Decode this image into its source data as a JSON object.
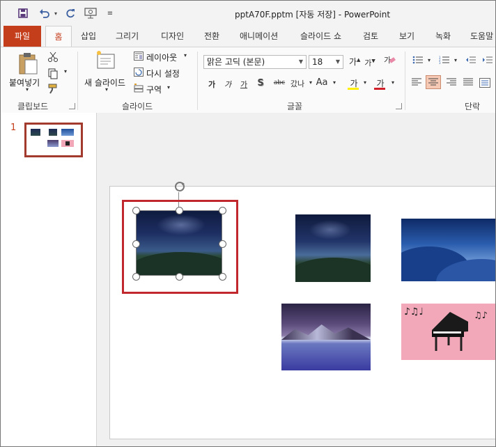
{
  "window": {
    "title": "pptA70F.pptm [자동 저장]  -  PowerPoint",
    "quick_access": [
      "save-icon",
      "undo-icon",
      "redo-icon",
      "present-icon",
      "customize-icon"
    ]
  },
  "tabs": [
    {
      "label": "파일"
    },
    {
      "label": "홈"
    },
    {
      "label": "삽입"
    },
    {
      "label": "그리기"
    },
    {
      "label": "디자인"
    },
    {
      "label": "전환"
    },
    {
      "label": "애니메이션"
    },
    {
      "label": "슬라이드 쇼"
    },
    {
      "label": "검토"
    },
    {
      "label": "보기"
    },
    {
      "label": "녹화"
    },
    {
      "label": "도움말"
    }
  ],
  "ribbon": {
    "clipboard": {
      "paste_label": "붙여넣기",
      "group_label": "클립보드"
    },
    "slides": {
      "new_slide_label": "새 슬라이드",
      "layout_label": "레이아웃",
      "reset_label": "다시 설정",
      "section_label": "구역",
      "group_label": "슬라이드"
    },
    "font": {
      "font_name": "맑은 고딕 (본문)",
      "font_size": "18",
      "group_label": "글꼴",
      "bold": "가",
      "italic": "가",
      "underline": "가",
      "shadow": "S",
      "strike": "abc",
      "spacing": "갔나",
      "case": "Aa",
      "highlight": "가",
      "color": "가",
      "grow": "가",
      "shrink": "가"
    },
    "paragraph": {
      "group_label": "단락"
    }
  },
  "thumbnails": [
    {
      "number": "1"
    }
  ],
  "colors": {
    "accent": "#c43e1c",
    "highlight_box": "#c0282d",
    "thumb_box": "#a33a2e"
  }
}
